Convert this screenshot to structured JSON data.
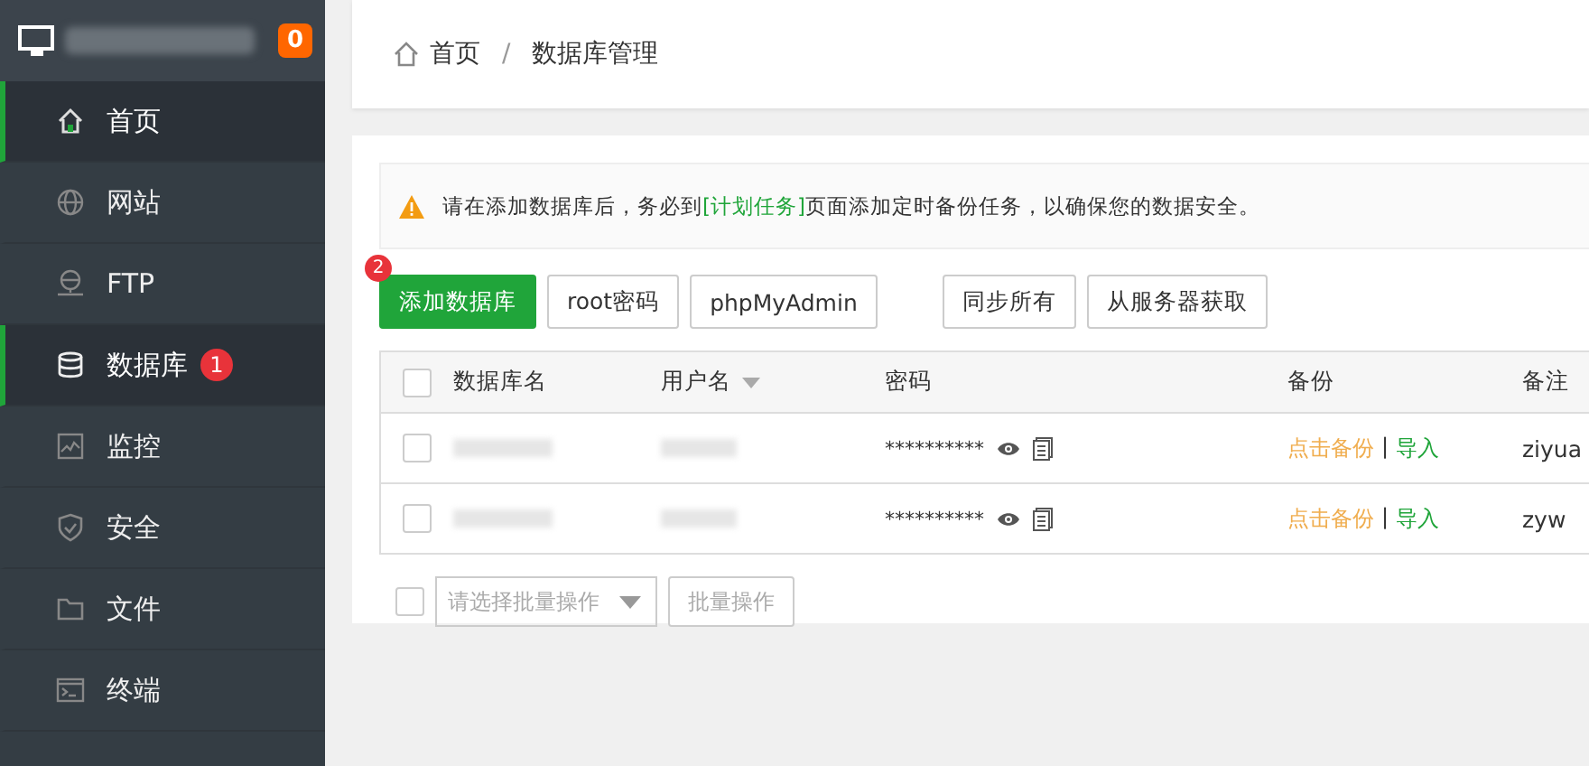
{
  "sidebar": {
    "badge": "0",
    "items": [
      {
        "label": "首页",
        "selected": true
      },
      {
        "label": "网站",
        "selected": false
      },
      {
        "label": "FTP",
        "selected": false
      },
      {
        "label": "数据库",
        "selected": true,
        "marker": "1"
      },
      {
        "label": "监控",
        "selected": false
      },
      {
        "label": "安全",
        "selected": false
      },
      {
        "label": "文件",
        "selected": false
      },
      {
        "label": "终端",
        "selected": false
      }
    ]
  },
  "breadcrumb": [
    "首页",
    "/",
    "数据库管理"
  ],
  "notice": {
    "before": "请在添加数据库后，务必到",
    "link": "[计划任务]",
    "after": "页面添加定时备份任务，以确保您的数据安全。"
  },
  "toolbar": [
    {
      "label": "添加数据库",
      "kind": "primary",
      "marker": "2"
    },
    {
      "label": "root密码",
      "kind": "plain"
    },
    {
      "label": "phpMyAdmin",
      "kind": "plain"
    },
    {
      "label": "同步所有",
      "kind": "plain"
    },
    {
      "label": "从服务器获取",
      "kind": "plain"
    }
  ],
  "table": {
    "all_checked": false,
    "columns": [
      "数据库名",
      "用户名",
      "密码",
      "备份",
      "备注"
    ],
    "rows": [
      {
        "checked": false,
        "password": "**********",
        "backup": "点击备份",
        "sep": "|",
        "import": "导入",
        "note": "ziyua"
      },
      {
        "checked": false,
        "password": "**********",
        "backup": "点击备份",
        "sep": "|",
        "import": "导入",
        "note": "zyw"
      }
    ]
  },
  "batch": {
    "checked": false,
    "placeholder": "请选择批量操作",
    "button": "批量操作"
  }
}
